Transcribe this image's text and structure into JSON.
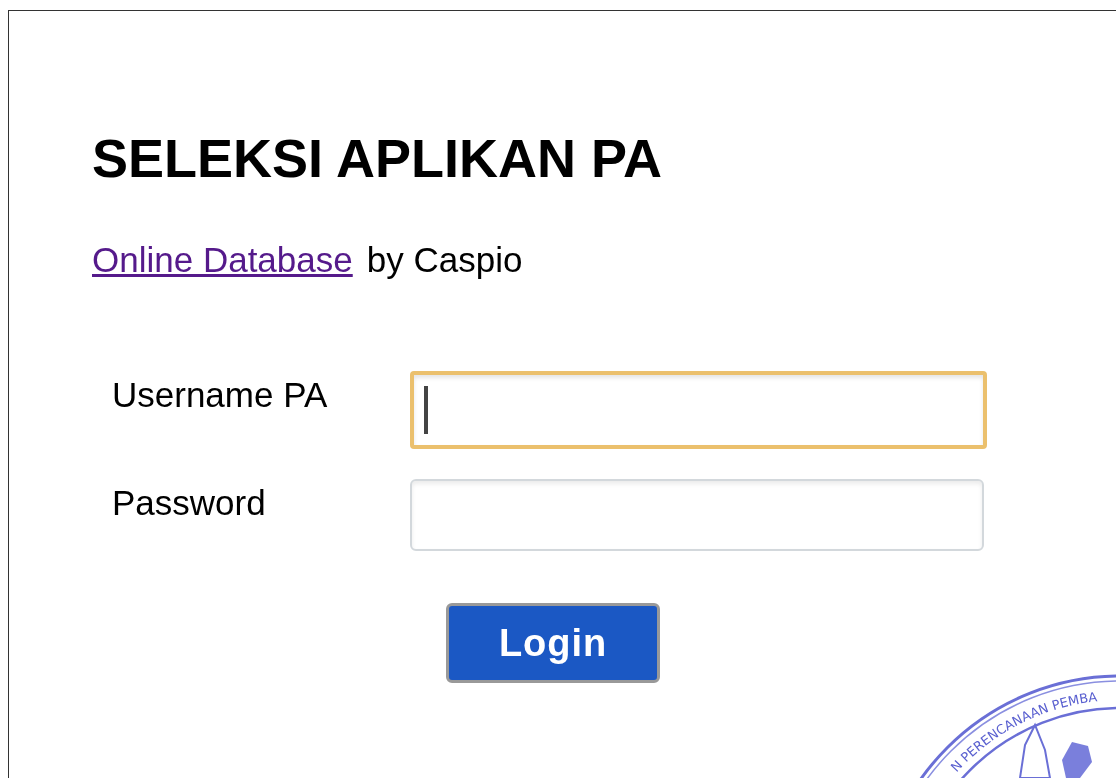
{
  "title": "SELEKSI APLIKAN PA",
  "byline": {
    "link": "Online Database",
    "text": "by Caspio"
  },
  "fields": [
    {
      "label": "Username PA",
      "focused": true
    },
    {
      "label": "Password",
      "focused": false
    }
  ],
  "button": "Login",
  "seal": {
    "text": "N PERENCANAAN PEMBA"
  }
}
